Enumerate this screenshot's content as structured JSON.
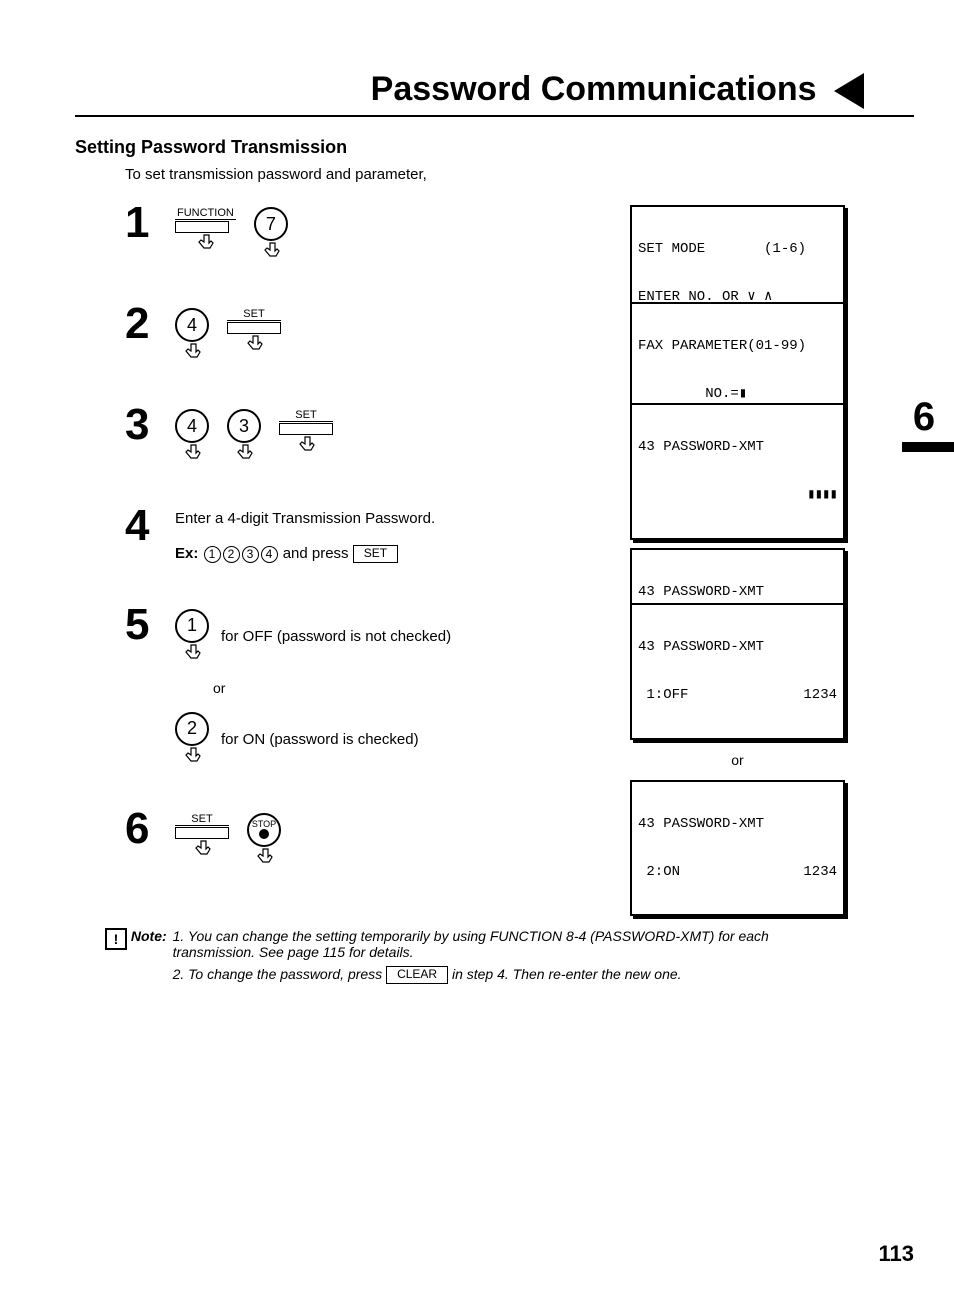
{
  "header": {
    "title": "Password Communications"
  },
  "section_title": "Setting Password Transmission",
  "intro": "To set transmission password and parameter,",
  "side_chapter": "6",
  "keys": {
    "function": "FUNCTION",
    "set": "SET",
    "stop": "STOP",
    "clear": "CLEAR",
    "d7": "7",
    "d4": "4",
    "d3": "3",
    "d1": "1",
    "d2": "2"
  },
  "steps": {
    "s1": {
      "num": "1"
    },
    "s2": {
      "num": "2"
    },
    "s3": {
      "num": "3"
    },
    "s4": {
      "num": "4",
      "text": "Enter a 4-digit Transmission Password.",
      "ex_label": "Ex:",
      "ex_digits": [
        "1",
        "2",
        "3",
        "4"
      ],
      "ex_mid": " and press "
    },
    "s5": {
      "num": "5",
      "off_text": "for OFF (password is not checked)",
      "or": "or",
      "on_text": "for ON (password is checked)"
    },
    "s6": {
      "num": "6"
    }
  },
  "lcd": {
    "s1_l1": "SET MODE       (1-6)",
    "s1_l2": "ENTER NO. OR ∨ ∧",
    "s2_l1": "FAX PARAMETER(01-99)",
    "s2_l2": "        NO.=▮",
    "s3_l1": "43 PASSWORD-XMT",
    "s3_blocks": "▮▮▮▮",
    "s4_l1": "43 PASSWORD-XMT",
    "s4_l2a": " 1:OFF",
    "s4_l2b": "1234",
    "s5a_l1": "43 PASSWORD-XMT",
    "s5a_l2a": " 1:OFF",
    "s5a_l2b": "1234",
    "s5_or": "or",
    "s5b_l1": "43 PASSWORD-XMT",
    "s5b_l2a": " 2:ON",
    "s5b_l2b": "1234"
  },
  "note": {
    "label": "Note:",
    "n1_pre": "1. You can change the setting temporarily by using FUNCTION 8-4 (PASSWORD-XMT) for each transmission.  See page 115 for details.",
    "n2_pre": "2. To change the password, press ",
    "n2_post": "  in step 4. Then re-enter the new one."
  },
  "page_number": "113"
}
